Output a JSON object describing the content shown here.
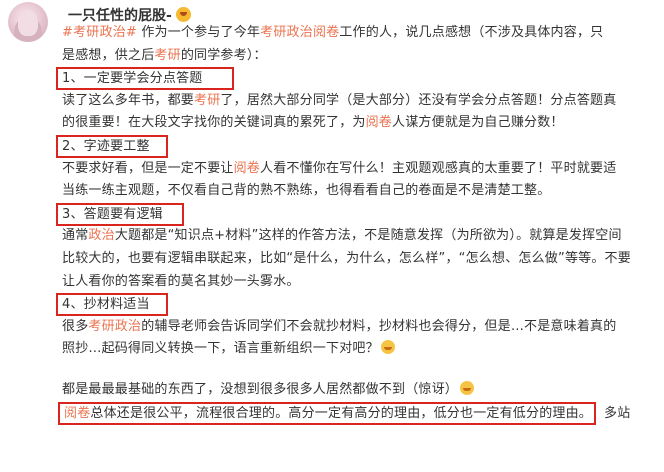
{
  "author": {
    "name": "一只任性的屁股-",
    "emoji_icon": "laughing-face-icon"
  },
  "post": {
    "intro_1": {
      "tag": "考研政治",
      "a": " 作为一个参与了今年",
      "hl": "考研政治阅卷",
      "b": "工作的人，说几点感想（不涉及具体内容，只"
    },
    "intro_2": {
      "a": "是感想，供之后",
      "hl": "考研",
      "b": "的同学参考）："
    },
    "point1": {
      "title": "1、一定要学会分点答题",
      "l1": {
        "a": "读了这么多年书，都要",
        "hl": "考研",
        "b": "了，居然大部分同学（是大部分）还没有学会分点答题！分点答题真"
      },
      "l2": {
        "a": "的很重要！在大段文字找你的关键词真的累死了，为",
        "hl": "阅卷",
        "b": "人谋方便就是为自己赚分数！"
      }
    },
    "point2": {
      "title": "2、字迹要工整",
      "l1": {
        "a": "不要求好看，但是一定不要让",
        "hl": "阅卷",
        "b": "人看不懂你在写什么！主观题观感真的太重要了！平时就要适"
      },
      "l2": {
        "a": "当练一练主观题，不仅看自己背的熟不熟练，也得看看自己的卷面是不是清楚工整。"
      }
    },
    "point3": {
      "title": "3、答题要有逻辑",
      "l1": {
        "a": "通常",
        "hl": "政治",
        "b": "大题都是“知识点+材料”这样的作答方法，不是随意发挥（为所欲为）。就算是发挥空间"
      },
      "l2": {
        "a": "比较大的，也要有逻辑串联起来，比如“是什么，为什么，怎么样”，“怎么想、怎么做”等等。不要"
      },
      "l3": {
        "a": "让人看你的答案看的莫名其妙一头雾水。"
      }
    },
    "point4": {
      "title": "4、抄材料适当",
      "l1": {
        "a": "很多",
        "hl": "考研政治",
        "b": "的辅导老师会告诉同学们不会就抄材料，抄材料也会得分，但是…不是意味着真的"
      },
      "l2": {
        "a": "照抄…起码得同义转换一下，语言重新组织一下对吧？",
        "emoji_icon": "laughing-tears-icon"
      }
    },
    "closing": {
      "l1": {
        "a": "都是最最最基础的东西了，没想到很多很多人居然都做不到（惊讶）",
        "emoji_icon": "laughing-tears-icon"
      },
      "l2": {
        "hl": "阅卷",
        "b": "总体还是很公平，流程很合理的。高分一定有高分的理由，低分也一定有低分的理由。",
        "trail": "多站"
      }
    }
  },
  "colors": {
    "highlight": "#eb7350",
    "box": "#d9251d",
    "text": "#333333"
  }
}
